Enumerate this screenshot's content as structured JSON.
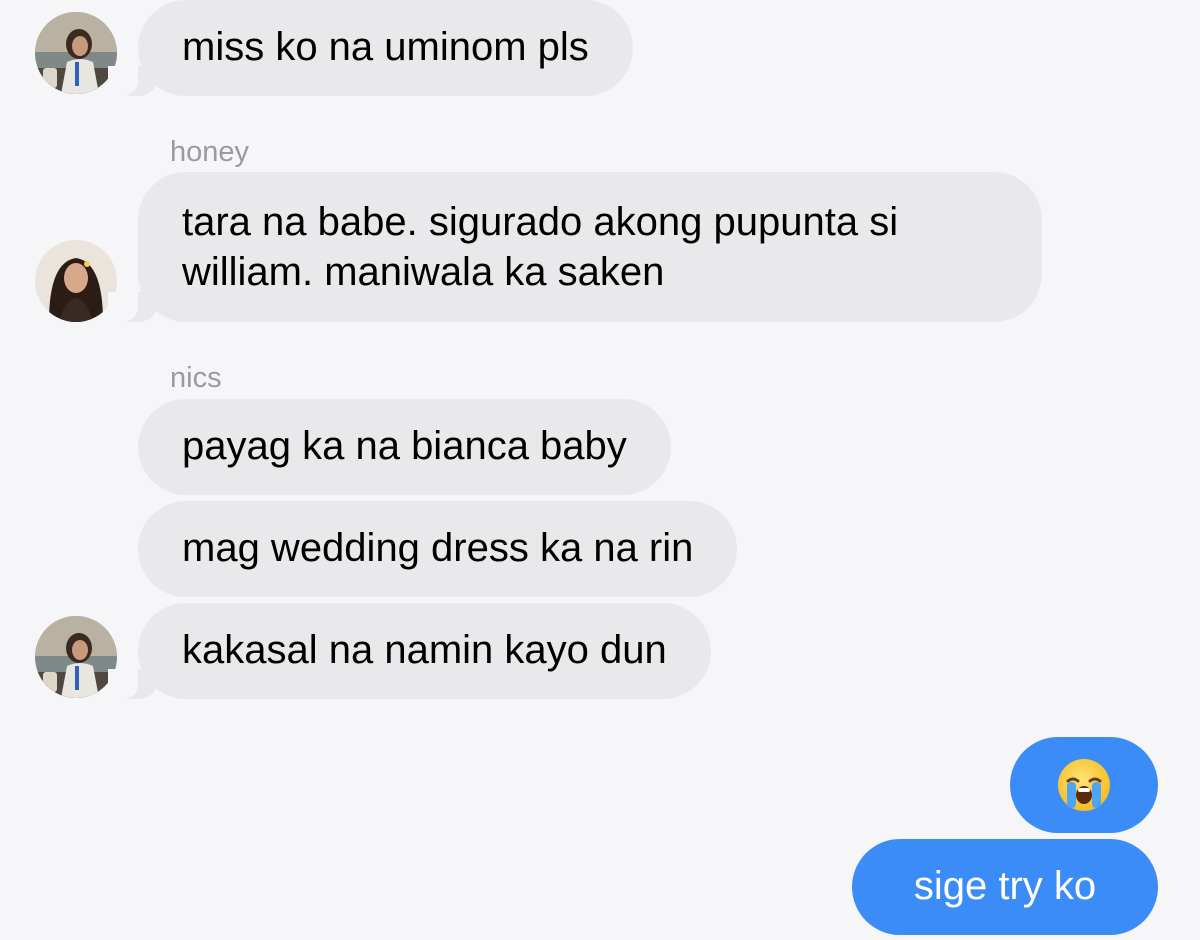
{
  "messages": [
    {
      "id": "m1",
      "direction": "incoming",
      "text": "miss ko na uminom pls"
    },
    {
      "id": "m2",
      "direction": "incoming",
      "sender": "honey",
      "lines": [
        "tara na babe. sigurado akong pupunta si",
        "william. maniwala ka saken"
      ]
    },
    {
      "id": "m3",
      "direction": "incoming",
      "sender": "nics",
      "text": "payag ka na bianca baby"
    },
    {
      "id": "m4",
      "direction": "incoming",
      "text": "mag wedding dress ka na rin"
    },
    {
      "id": "m5",
      "direction": "incoming",
      "text": "kakasal na namin kayo dun"
    },
    {
      "id": "m6",
      "direction": "outgoing",
      "emoji": "loudly-crying-face-emoji"
    },
    {
      "id": "m7",
      "direction": "outgoing",
      "text": "sige try ko"
    }
  ],
  "colors": {
    "background": "#f6f6f8",
    "incoming_bubble": "#e9e9eb",
    "outgoing_bubble": "#3b8cf7",
    "sender_label": "#9b9b9f"
  }
}
